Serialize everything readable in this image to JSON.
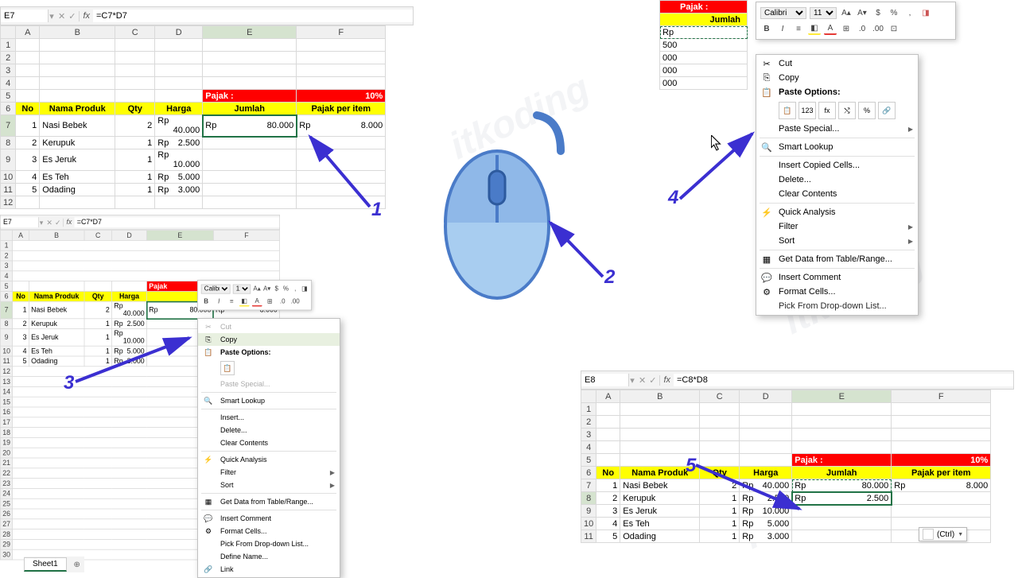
{
  "formula": {
    "E7": {
      "nameBox": "E7",
      "formula": "=C7*D7"
    },
    "E8": {
      "nameBox": "E8",
      "formula": "=C8*D8"
    }
  },
  "columns": [
    "A",
    "B",
    "C",
    "D",
    "E",
    "F"
  ],
  "tax": {
    "label": "Pajak :",
    "value": "10%"
  },
  "headers": {
    "no": "No",
    "nama": "Nama Produk",
    "qty": "Qty",
    "harga": "Harga",
    "jumlah": "Jumlah",
    "pajak": "Pajak per item"
  },
  "rows": [
    {
      "no": "1",
      "nama": "Nasi Bebek",
      "qty": "2",
      "harga_cur": "Rp",
      "harga": "40.000",
      "jumlah_cur": "Rp",
      "jumlah": "80.000",
      "pajak_cur": "Rp",
      "pajak": "8.000"
    },
    {
      "no": "2",
      "nama": "Kerupuk",
      "qty": "1",
      "harga_cur": "Rp",
      "harga": "2.500",
      "jumlah_cur": "Rp",
      "jumlah": "2.500",
      "pajak_cur": "",
      "pajak": ""
    },
    {
      "no": "3",
      "nama": "Es Jeruk",
      "qty": "1",
      "harga_cur": "Rp",
      "harga": "10.000",
      "jumlah_cur": "",
      "jumlah": "",
      "pajak_cur": "",
      "pajak": ""
    },
    {
      "no": "4",
      "nama": "Es Teh",
      "qty": "1",
      "harga_cur": "Rp",
      "harga": "5.000",
      "jumlah_cur": "",
      "jumlah": "",
      "pajak_cur": "",
      "pajak": ""
    },
    {
      "no": "5",
      "nama": "Odading",
      "qty": "1",
      "harga_cur": "Rp",
      "harga": "3.000",
      "jumlah_cur": "",
      "jumlah": "",
      "pajak_cur": "",
      "pajak": ""
    }
  ],
  "panel2": {
    "jumlahRemain": "500",
    "rowTailCur": "Rp",
    "sideVals": [
      "500",
      "000",
      "000",
      "000"
    ]
  },
  "miniToolbar": {
    "font": "Calibri",
    "size": "11"
  },
  "context": {
    "cut": "Cut",
    "copy": "Copy",
    "pasteOptions": "Paste Options:",
    "pasteSpecial": "Paste Special...",
    "smartLookup": "Smart Lookup",
    "insert": "Insert...",
    "insertCopied": "Insert Copied Cells...",
    "delete": "Delete...",
    "clear": "Clear Contents",
    "quick": "Quick Analysis",
    "filter": "Filter",
    "sort": "Sort",
    "getData": "Get Data from Table/Range...",
    "comment": "Insert Comment",
    "format": "Format Cells...",
    "dropdown": "Pick From Drop-down List...",
    "defineName": "Define Name...",
    "link": "Link"
  },
  "sheetTab": {
    "name": "Sheet1"
  },
  "ctrlBtn": "(Ctrl)",
  "anno": {
    "1": "1",
    "2": "2",
    "3": "3",
    "4": "4",
    "5": "5"
  }
}
